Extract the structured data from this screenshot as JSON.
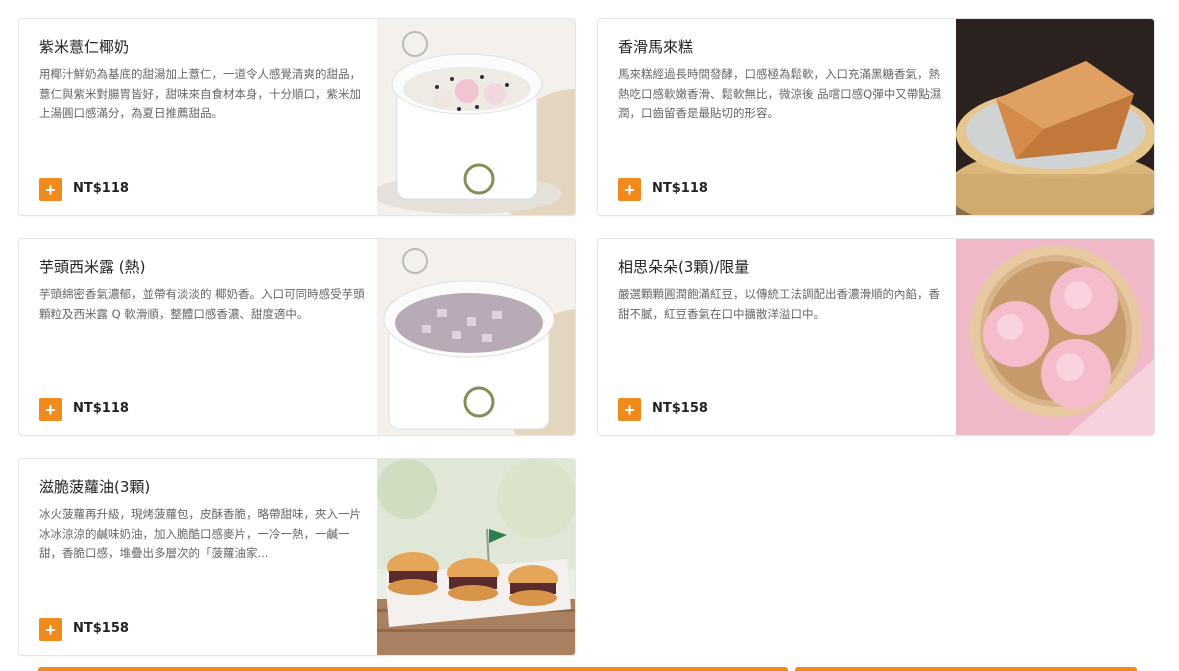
{
  "currency_brand_color": "#f08a1c",
  "items": [
    {
      "title": "紫米薏仁椰奶",
      "description": "用椰汁鮮奶為基底的甜湯加上薏仁，一道令人感覺清爽的甜品，薏仁與紫米對腸胃皆好，甜味來自食材本身，十分順口，紫米加上湯圓口感滿分，為夏日推薦甜品。",
      "price": "NT$118",
      "image": "purple-rice-coconut-milk-dessert"
    },
    {
      "title": "香滑馬來糕",
      "description": "馬來糕經過長時間發酵，口感極為鬆軟，入口充滿黑糖香氣，熱熱吃口感軟嫩香滑、鬆軟無比，微涼後 品嚐口感Q彈中又帶點濕潤，口齒留香是最貼切的形容。",
      "price": "NT$118",
      "image": "malay-sponge-cake"
    },
    {
      "title": "芋頭西米露 (熱)",
      "description": "芋頭綿密香氣濃郁，並帶有淡淡的 椰奶香。入口可同時感受芋頭顆粒及西米露 Q 軟滑順，整體口感香濃、甜度適中。",
      "price": "NT$118",
      "image": "taro-sago-soup"
    },
    {
      "title": "相思朵朵(3顆)/限量",
      "description": "嚴選顆顆圓潤飽滿紅豆，以傳統工法調配出香濃滑順的內餡，香甜不膩，紅豆香氣在口中擴散洋溢口中。",
      "price": "NT$158",
      "image": "pink-heart-buns"
    },
    {
      "title": "滋脆菠蘿油(3顆)",
      "description": "冰火菠蘿再升級，現烤菠蘿包，皮酥香脆，略帶甜味，夾入一片冰冰涼涼的鹹味奶油，加入脆酷口感麥片，一冷一熱，一鹹一甜，香脆口感，堆疊出多層次的「菠蘿油家...",
      "price": "NT$158",
      "image": "pineapple-buns-with-butter"
    }
  ],
  "add_button_label": "+"
}
